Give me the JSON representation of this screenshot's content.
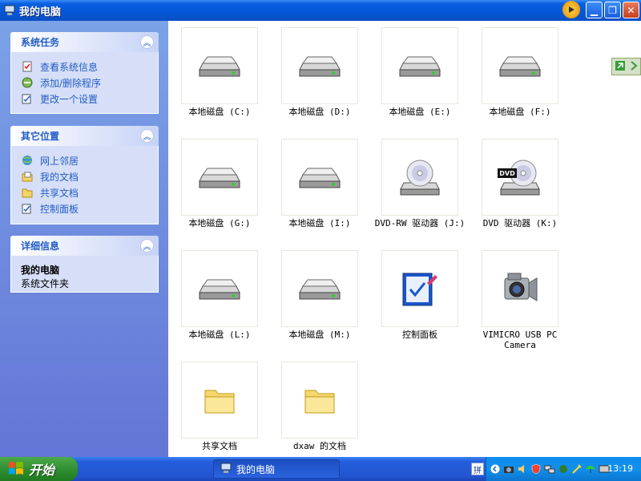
{
  "window": {
    "title": "我的电脑"
  },
  "taskpane": {
    "system_tasks": {
      "title": "系统任务",
      "items": [
        {
          "label": "查看系统信息",
          "icon": "system-info-icon"
        },
        {
          "label": "添加/删除程序",
          "icon": "add-remove-programs-icon"
        },
        {
          "label": "更改一个设置",
          "icon": "control-panel-icon"
        }
      ]
    },
    "other_places": {
      "title": "其它位置",
      "items": [
        {
          "label": "网上邻居",
          "icon": "network-places-icon"
        },
        {
          "label": "我的文档",
          "icon": "my-documents-icon"
        },
        {
          "label": "共享文档",
          "icon": "shared-folder-icon"
        },
        {
          "label": "控制面板",
          "icon": "control-panel-icon"
        }
      ]
    },
    "details": {
      "title": "详细信息",
      "name": "我的电脑",
      "type": "系统文件夹"
    }
  },
  "items": [
    {
      "label": "本地磁盘 (C:)",
      "icon": "hard-drive-icon"
    },
    {
      "label": "本地磁盘 (D:)",
      "icon": "hard-drive-icon"
    },
    {
      "label": "本地磁盘 (E:)",
      "icon": "hard-drive-icon"
    },
    {
      "label": "本地磁盘 (F:)",
      "icon": "hard-drive-icon"
    },
    {
      "label": "本地磁盘 (G:)",
      "icon": "hard-drive-icon"
    },
    {
      "label": "本地磁盘 (I:)",
      "icon": "hard-drive-icon"
    },
    {
      "label": "DVD-RW 驱动器 (J:)",
      "icon": "dvd-rw-drive-icon"
    },
    {
      "label": "DVD 驱动器 (K:)",
      "icon": "dvd-drive-icon"
    },
    {
      "label": "本地磁盘 (L:)",
      "icon": "hard-drive-icon"
    },
    {
      "label": "本地磁盘 (M:)",
      "icon": "hard-drive-icon"
    },
    {
      "label": "控制面板",
      "icon": "control-panel-icon"
    },
    {
      "label": "VIMICRO USB PC Camera",
      "icon": "camera-icon"
    },
    {
      "label": "共享文档",
      "icon": "folder-icon"
    },
    {
      "label": "dxaw 的文档",
      "icon": "folder-icon"
    }
  ],
  "dvd_badge": "DVD",
  "taskbar": {
    "start_label": "开始",
    "active_window": "我的电脑",
    "ime_label": "拼",
    "clock": "13:19"
  }
}
